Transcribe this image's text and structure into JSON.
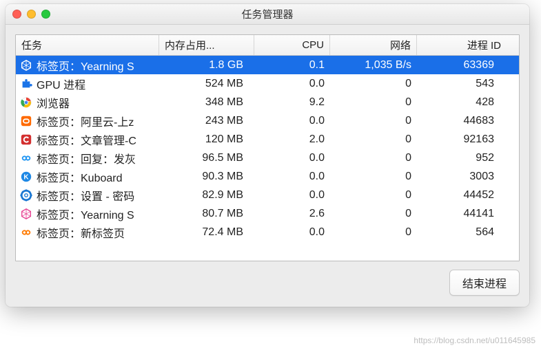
{
  "window": {
    "title": "任务管理器"
  },
  "headers": {
    "task": "任务",
    "memory": "内存占用...",
    "cpu": "CPU",
    "network": "网络",
    "pid": "进程 ID"
  },
  "rows": [
    {
      "icon": "cube-pink",
      "selected": true,
      "task": "标签页：Yearning S",
      "memory": "1.8 GB",
      "cpu": "0.1",
      "network": "1,035 B/s",
      "pid": "63369"
    },
    {
      "icon": "puzzle-blue",
      "selected": false,
      "task": "GPU 进程",
      "memory": "524 MB",
      "cpu": "0.0",
      "network": "0",
      "pid": "543"
    },
    {
      "icon": "chrome",
      "selected": false,
      "task": "浏览器",
      "memory": "348 MB",
      "cpu": "9.2",
      "network": "0",
      "pid": "428"
    },
    {
      "icon": "square-orange",
      "selected": false,
      "task": "标签页：阿里云-上z",
      "memory": "243 MB",
      "cpu": "0.0",
      "network": "0",
      "pid": "44683"
    },
    {
      "icon": "square-red-c",
      "selected": false,
      "task": "标签页：文章管理-C",
      "memory": "120 MB",
      "cpu": "2.0",
      "network": "0",
      "pid": "92163"
    },
    {
      "icon": "infinity-blue",
      "selected": false,
      "task": "标签页：回复：发灰",
      "memory": "96.5 MB",
      "cpu": "0.0",
      "network": "0",
      "pid": "952"
    },
    {
      "icon": "circle-blue-k",
      "selected": false,
      "task": "标签页：Kuboard",
      "memory": "90.3 MB",
      "cpu": "0.0",
      "network": "0",
      "pid": "3003"
    },
    {
      "icon": "gear-blue",
      "selected": false,
      "task": "标签页：设置 - 密码",
      "memory": "82.9 MB",
      "cpu": "0.0",
      "network": "0",
      "pid": "44452"
    },
    {
      "icon": "cube-pink",
      "selected": false,
      "task": "标签页：Yearning S",
      "memory": "80.7 MB",
      "cpu": "2.6",
      "network": "0",
      "pid": "44141"
    },
    {
      "icon": "infinity-orange",
      "selected": false,
      "task": "标签页：新标签页",
      "memory": "72.4 MB",
      "cpu": "0.0",
      "network": "0",
      "pid": "564"
    }
  ],
  "buttons": {
    "end_process": "结束进程"
  },
  "watermark": "https://blog.csdn.net/u011645985",
  "icon_colors": {
    "cube-pink": "#e74694",
    "puzzle-blue": "#1a73e8",
    "chrome": "#4285f4",
    "square-orange": "#ff6a00",
    "square-red-c": "#d32f2f",
    "infinity-blue": "#2196f3",
    "circle-blue-k": "#1e88e5",
    "gear-blue": "#1976d2",
    "infinity-orange": "#ff7a00"
  }
}
